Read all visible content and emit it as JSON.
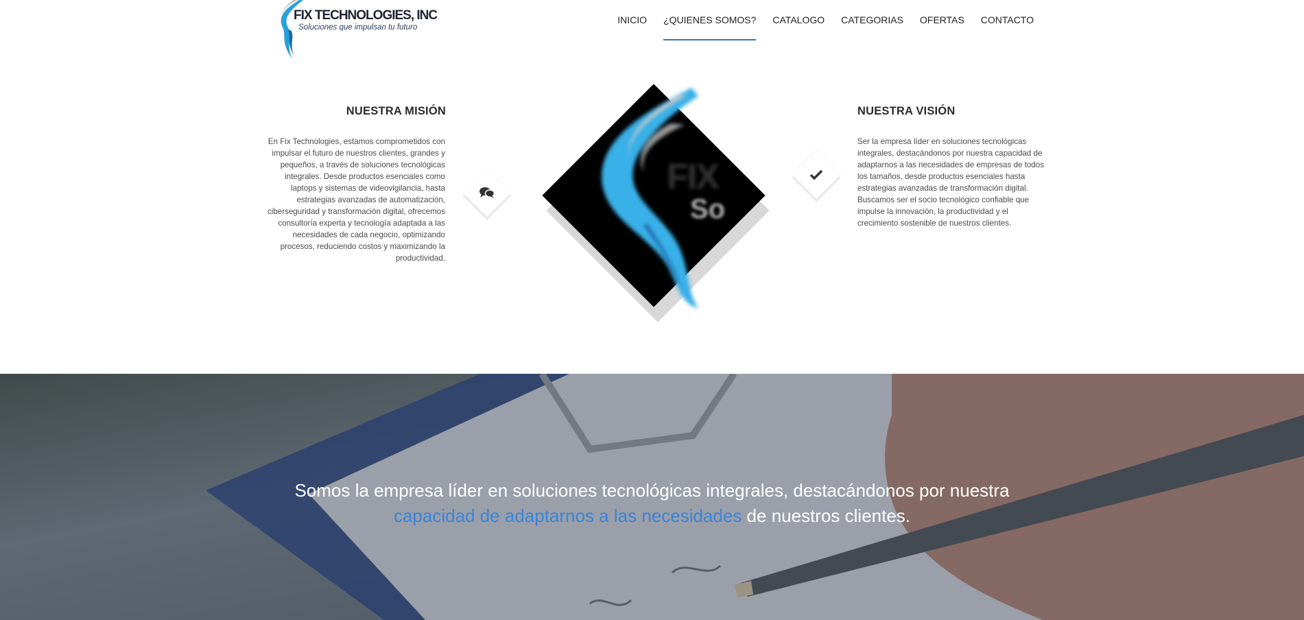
{
  "header": {
    "logo": {
      "title": "FIX TECHNOLOGIES, INC",
      "tagline": "Soluciones que impulsan tu futuro"
    },
    "nav": [
      {
        "label": "INICIO",
        "active": false
      },
      {
        "label": "¿QUIENES SOMOS?",
        "active": true
      },
      {
        "label": "CATALOGO",
        "active": false
      },
      {
        "label": "CATEGORIAS",
        "active": false
      },
      {
        "label": "OFERTAS",
        "active": false
      },
      {
        "label": "CONTACTO",
        "active": false
      }
    ]
  },
  "mission": {
    "title": "NUESTRA MISIÓN",
    "text": "En Fix Technologies, estamos comprometidos con impulsar el futuro de nuestros clientes, grandes y pequeños, a través de soluciones tecnológicas integrales. Desde productos esenciales como laptops y sistemas de videovigilancia, hasta estrategias avanzadas de automatización, ciberseguridad y transformación digital, ofrecemos consultoría experta y tecnología adaptada a las necesidades de cada negocio, optimizando procesos, reduciendo costos y maximizando la productividad.",
    "icon": "comments-icon"
  },
  "vision": {
    "title": "NUESTRA VISIÓN",
    "text": "Ser la empresa líder en soluciones tecnológicas integrales, destacándonos por nuestra capacidad de adaptarnos a las necesidades de empresas de todos los tamaños, desde productos esenciales hasta estrategias avanzadas de transformación digital. Buscamos ser el socio tecnológico confiable que impulse la innovación, la productividad y el crecimiento sostenible de nuestros clientes.",
    "icon": "check-icon"
  },
  "center_logo": {
    "text_a": "FIX",
    "text_b": "So"
  },
  "hero": {
    "line1": "Somos la empresa líder en soluciones tecnológicas integrales, destacándonos por nuestra",
    "highlight": "capacidad de adaptarnos a las necesidades",
    "line2_rest": " de nuestros clientes."
  },
  "colors": {
    "accent": "#2f76b9",
    "highlight": "#3a84d8",
    "dark": "#2b2b2b"
  }
}
